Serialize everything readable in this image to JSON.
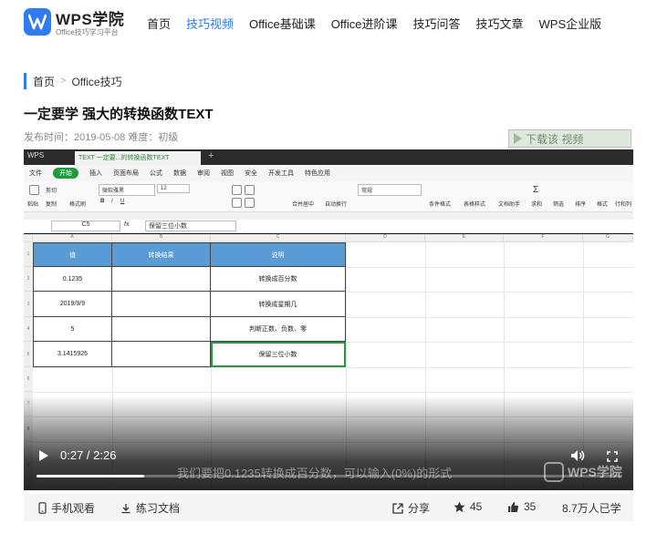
{
  "header": {
    "brand": "WPS学院",
    "brand_sub": "Office技巧学习平台",
    "nav": [
      {
        "label": "首页",
        "active": false
      },
      {
        "label": "技巧视频",
        "active": true
      },
      {
        "label": "Office基础课",
        "active": false
      },
      {
        "label": "Office进阶课",
        "active": false
      },
      {
        "label": "技巧问答",
        "active": false
      },
      {
        "label": "技巧文章",
        "active": false
      },
      {
        "label": "WPS企业版",
        "active": false
      }
    ]
  },
  "breadcrumb": {
    "home": "首页",
    "separator": ">",
    "current": "Office技巧"
  },
  "article": {
    "title": "一定要学 强大的转换函数TEXT",
    "meta": "发布时间：2019-05-08 难度：初级"
  },
  "download_badge": "下载该 视频",
  "video": {
    "wps": {
      "app_tab": "WPS",
      "doc_tab": "TEXT 一定要...的转换函数TEXT",
      "menu": [
        "文件",
        "开始",
        "插入",
        "页面布局",
        "公式",
        "数据",
        "审阅",
        "视图",
        "安全",
        "开发工具",
        "特色应用"
      ],
      "ribbon": {
        "paste": "粘贴",
        "cut": "剪切",
        "copy": "复制",
        "format_painter": "格式刷",
        "font_name": "微软雅黑",
        "font_size": "12",
        "merge": "合并居中",
        "wrap": "自动换行",
        "number_format": "常规",
        "cond_format": "条件格式",
        "table_style": "表格样式",
        "doc_helper": "文档助手",
        "sum": "求和",
        "filter": "筛选",
        "sort": "排序",
        "format": "格式",
        "rows_cols": "行和列",
        "search": "Q 直接在命令"
      },
      "cell_ref": "C5",
      "fx": "fx",
      "formula": "保留三位小数",
      "columns": [
        "A",
        "B",
        "C",
        "D",
        "E",
        "F",
        "G"
      ],
      "rows": [
        "1",
        "2",
        "3",
        "4",
        "5",
        "6",
        "7",
        "8",
        "9"
      ],
      "table": {
        "headers": [
          "值",
          "转换结果",
          "说明"
        ],
        "data": [
          [
            "0.1235",
            "",
            "转换成百分数"
          ],
          [
            "2019/9/9",
            "",
            "转换成星期几"
          ],
          [
            "5",
            "",
            "判断正数、负数、零"
          ],
          [
            "3.1415926",
            "",
            "保留三位小数"
          ]
        ]
      }
    },
    "subtitle": "我们要把0.1235转换成百分数，可以输入(0%)的形式",
    "watermark": "WPS学院",
    "time": "0:27 / 2:26",
    "progress": 0.184
  },
  "bottom": {
    "mobile": "手机观看",
    "practice": "练习文档",
    "share": "分享",
    "favorites": "45",
    "likes": "35",
    "views": "8.7万人已学"
  },
  "colors": {
    "accent": "#2f7bf0",
    "excel_green": "#1f9a3e",
    "table_header": "#5b9bd5"
  }
}
